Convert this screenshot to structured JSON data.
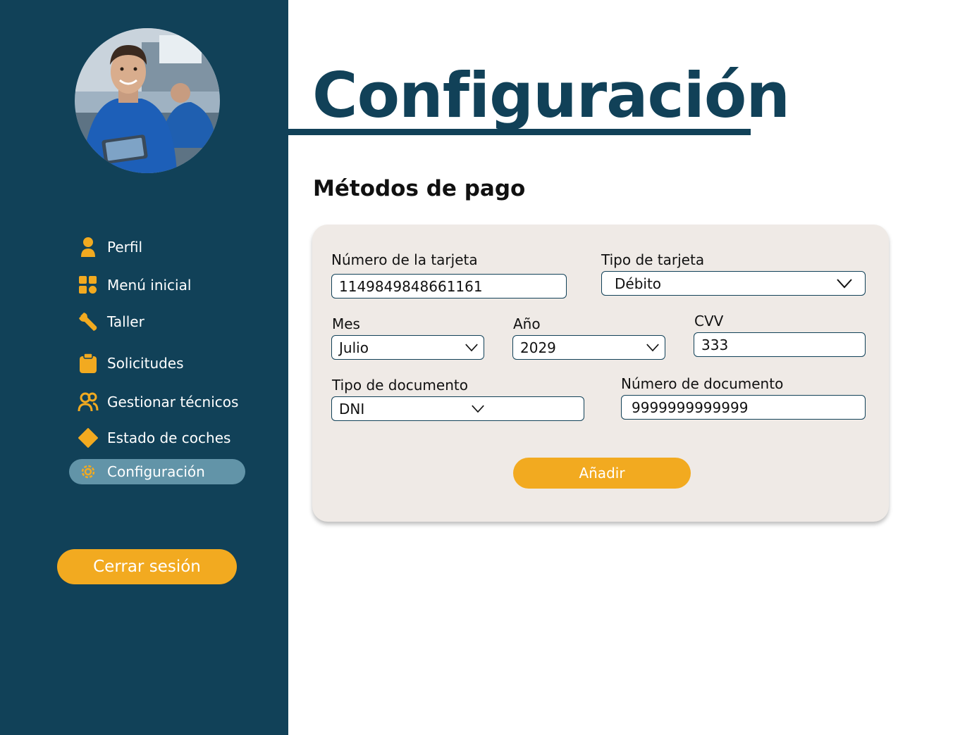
{
  "sidebar": {
    "items": [
      {
        "label": "Perfil",
        "icon": "person-icon"
      },
      {
        "label": "Menú inicial",
        "icon": "dashboard-icon"
      },
      {
        "label": "Taller",
        "icon": "wrench-icon"
      },
      {
        "label": "Solicitudes",
        "icon": "clipboard-icon"
      },
      {
        "label": "Gestionar técnicos",
        "icon": "people-icon"
      },
      {
        "label": "Estado de coches",
        "icon": "diamond-icon"
      },
      {
        "label": "Configuración",
        "icon": "gear-icon",
        "active": true
      }
    ],
    "logout_label": "Cerrar sesión"
  },
  "main": {
    "title": "Configuración",
    "section_title": "Métodos de pago",
    "form": {
      "card_number_label": "Número de la tarjeta",
      "card_number_value": "1149849848661161",
      "card_type_label": "Tipo de tarjeta",
      "card_type_value": "Débito",
      "month_label": "Mes",
      "month_value": "Julio",
      "year_label": "Año",
      "year_value": "2029",
      "cvv_label": "CVV",
      "cvv_value": "333",
      "doc_type_label": "Tipo de documento",
      "doc_type_value": "DNI",
      "doc_number_label": "Número de documento",
      "doc_number_value": "9999999999999",
      "submit_label": "Añadir"
    }
  },
  "colors": {
    "sidebar_bg": "#114158",
    "accent": "#f2aa20",
    "active_item_bg": "#6294a8",
    "card_bg": "#efeae6",
    "title": "#114158"
  }
}
